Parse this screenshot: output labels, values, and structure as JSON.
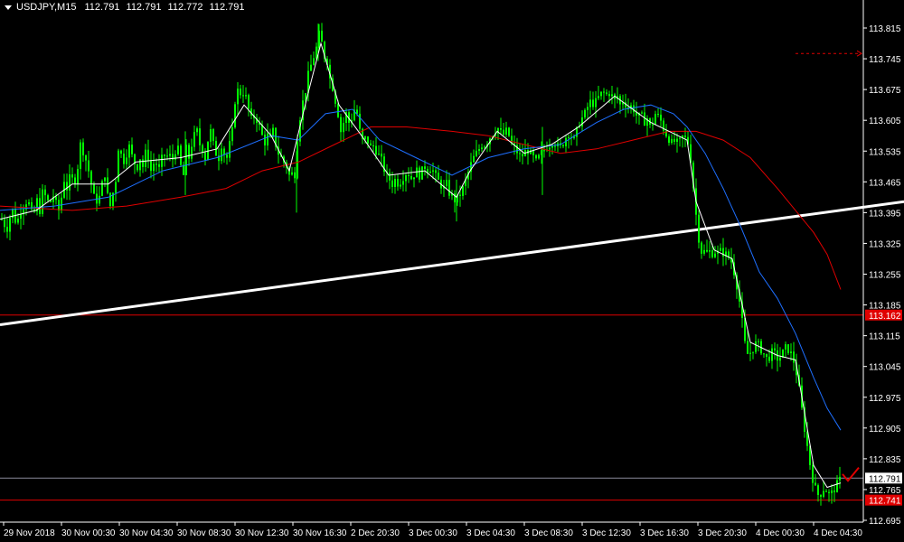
{
  "header": {
    "symbol": "USDJPY,M15",
    "open": "112.791",
    "high": "112.791",
    "low": "112.772",
    "close": "112.791"
  },
  "colors": {
    "background": "#000000",
    "axis": "#ffffff",
    "candle": "#00ff00",
    "ma_fast": "#ffffff",
    "ma_mid": "#1e6fff",
    "ma_slow": "#e00000",
    "trendline": "#ffffff",
    "level_line": "#e00000",
    "bid_line": "#8a8a9a",
    "tag_bg_red": "#e00000",
    "checkmark": "#e00000"
  },
  "icons": {
    "menu": "triangle-down-icon",
    "annotation": "red-checkmark-icon"
  },
  "chart_data": {
    "type": "candlestick",
    "ylim": [
      112.695,
      113.835
    ],
    "price_ticks": [
      "113.815",
      "113.745",
      "113.675",
      "113.605",
      "113.535",
      "113.465",
      "113.395",
      "113.325",
      "113.255",
      "113.185",
      "113.115",
      "113.045",
      "112.975",
      "112.905",
      "112.835",
      "112.765",
      "112.695"
    ],
    "time_ticks": [
      "29 Nov 2018",
      "30 Nov 00:30",
      "30 Nov 04:30",
      "30 Nov 08:30",
      "30 Nov 12:30",
      "30 Nov 16:30",
      "2 Dec 20:30",
      "3 Dec 00:30",
      "3 Dec 04:30",
      "3 Dec 08:30",
      "3 Dec 12:30",
      "3 Dec 16:30",
      "3 Dec 20:30",
      "4 Dec 00:30",
      "4 Dec 04:30"
    ],
    "price_tags": [
      {
        "name": "level-upper",
        "label": "113.162",
        "value": 113.162
      },
      {
        "name": "bid",
        "label": "112.791",
        "value": 112.791
      },
      {
        "name": "level-lower",
        "label": "112.741",
        "value": 112.741
      }
    ],
    "dotted_level": 113.757,
    "close_path": [
      [
        0,
        113.39
      ],
      [
        4,
        113.37
      ],
      [
        8,
        113.36
      ],
      [
        10,
        113.38
      ],
      [
        14,
        113.4
      ],
      [
        18,
        113.37
      ],
      [
        22,
        113.39
      ],
      [
        25,
        113.42
      ],
      [
        27,
        113.4
      ],
      [
        30,
        113.43
      ],
      [
        34,
        113.4
      ],
      [
        37,
        113.38
      ],
      [
        40,
        113.43
      ],
      [
        44,
        113.4
      ],
      [
        47,
        113.44
      ],
      [
        51,
        113.43
      ],
      [
        55,
        113.41
      ],
      [
        58,
        113.44
      ],
      [
        61,
        113.42
      ],
      [
        65,
        113.4
      ],
      [
        68,
        113.43
      ],
      [
        71,
        113.47
      ],
      [
        74,
        113.45
      ],
      [
        78,
        113.48
      ],
      [
        82,
        113.46
      ],
      [
        86,
        113.5
      ],
      [
        89,
        113.55
      ],
      [
        93,
        113.53
      ],
      [
        97,
        113.5
      ],
      [
        101,
        113.46
      ],
      [
        104,
        113.43
      ],
      [
        108,
        113.42
      ],
      [
        112,
        113.44
      ],
      [
        115,
        113.5
      ],
      [
        118,
        113.45
      ],
      [
        121,
        113.4
      ],
      [
        125,
        113.44
      ],
      [
        128,
        113.47
      ],
      [
        130,
        113.55
      ],
      [
        133,
        113.53
      ],
      [
        136,
        113.52
      ],
      [
        139,
        113.5
      ],
      [
        141,
        113.56
      ],
      [
        145,
        113.53
      ],
      [
        148,
        113.51
      ],
      [
        152,
        113.5
      ],
      [
        155,
        113.52
      ],
      [
        158,
        113.5
      ],
      [
        161,
        113.53
      ],
      [
        164,
        113.52
      ],
      [
        168,
        113.48
      ],
      [
        171,
        113.52
      ],
      [
        174,
        113.5
      ],
      [
        177,
        113.49
      ],
      [
        180,
        113.53
      ],
      [
        184,
        113.52
      ],
      [
        187,
        113.53
      ],
      [
        190,
        113.51
      ],
      [
        193,
        113.53
      ],
      [
        196,
        113.55
      ],
      [
        200,
        113.5
      ],
      [
        203,
        113.48
      ],
      [
        206,
        113.54
      ],
      [
        209,
        113.52
      ],
      [
        212,
        113.55
      ],
      [
        215,
        113.57
      ],
      [
        218,
        113.58
      ],
      [
        221,
        113.55
      ],
      [
        224,
        113.54
      ],
      [
        227,
        113.52
      ],
      [
        230,
        113.56
      ],
      [
        233,
        113.58
      ],
      [
        236,
        113.55
      ],
      [
        239,
        113.53
      ],
      [
        242,
        113.52
      ],
      [
        245,
        113.55
      ],
      [
        248,
        113.53
      ],
      [
        251,
        113.52
      ],
      [
        254,
        113.55
      ],
      [
        257,
        113.58
      ],
      [
        260,
        113.65
      ],
      [
        264,
        113.68
      ],
      [
        267,
        113.66
      ],
      [
        270,
        113.67
      ],
      [
        273,
        113.65
      ],
      [
        276,
        113.62
      ],
      [
        279,
        113.6
      ],
      [
        282,
        113.62
      ],
      [
        285,
        113.6
      ],
      [
        289,
        113.58
      ],
      [
        292,
        113.55
      ],
      [
        296,
        113.57
      ],
      [
        299,
        113.56
      ],
      [
        302,
        113.58
      ],
      [
        305,
        113.55
      ],
      [
        308,
        113.53
      ],
      [
        311,
        113.52
      ],
      [
        314,
        113.51
      ],
      [
        317,
        113.5
      ],
      [
        320,
        113.48
      ],
      [
        322,
        113.5
      ],
      [
        325,
        113.45
      ],
      [
        328,
        113.55
      ],
      [
        331,
        113.6
      ],
      [
        334,
        113.64
      ],
      [
        337,
        113.66
      ],
      [
        340,
        113.7
      ],
      [
        344,
        113.73
      ],
      [
        347,
        113.75
      ],
      [
        350,
        113.77
      ],
      [
        353,
        113.8
      ],
      [
        356,
        113.78
      ],
      [
        359,
        113.75
      ],
      [
        362,
        113.74
      ],
      [
        365,
        113.7
      ],
      [
        368,
        113.68
      ],
      [
        371,
        113.65
      ],
      [
        374,
        113.62
      ],
      [
        377,
        113.58
      ],
      [
        380,
        113.6
      ],
      [
        383,
        113.62
      ],
      [
        386,
        113.6
      ],
      [
        389,
        113.61
      ],
      [
        392,
        113.63
      ],
      [
        395,
        113.62
      ],
      [
        398,
        113.58
      ],
      [
        402,
        113.55
      ],
      [
        405,
        113.57
      ],
      [
        408,
        113.55
      ],
      [
        411,
        113.54
      ],
      [
        414,
        113.55
      ],
      [
        417,
        113.53
      ],
      [
        421,
        113.52
      ],
      [
        424,
        113.5
      ],
      [
        427,
        113.48
      ],
      [
        431,
        113.47
      ],
      [
        434,
        113.46
      ],
      [
        437,
        113.47
      ],
      [
        441,
        113.46
      ],
      [
        444,
        113.47
      ],
      [
        447,
        113.48
      ],
      [
        451,
        113.49
      ],
      [
        454,
        113.47
      ],
      [
        457,
        113.48
      ],
      [
        461,
        113.49
      ],
      [
        464,
        113.48
      ],
      [
        467,
        113.49
      ],
      [
        470,
        113.5
      ],
      [
        474,
        113.49
      ],
      [
        477,
        113.5
      ],
      [
        481,
        113.48
      ],
      [
        484,
        113.47
      ],
      [
        487,
        113.46
      ],
      [
        491,
        113.45
      ],
      [
        494,
        113.46
      ],
      [
        497,
        113.44
      ],
      [
        501,
        113.43
      ],
      [
        504,
        113.42
      ],
      [
        507,
        113.43
      ],
      [
        510,
        113.44
      ],
      [
        514,
        113.46
      ],
      [
        517,
        113.48
      ],
      [
        520,
        113.5
      ],
      [
        524,
        113.52
      ],
      [
        527,
        113.53
      ],
      [
        530,
        113.54
      ],
      [
        533,
        113.55
      ],
      [
        536,
        113.55
      ],
      [
        540,
        113.56
      ],
      [
        543,
        113.57
      ],
      [
        547,
        113.58
      ],
      [
        550,
        113.59
      ],
      [
        553,
        113.58
      ],
      [
        556,
        113.57
      ],
      [
        560,
        113.58
      ],
      [
        563,
        113.57
      ],
      [
        566,
        113.55
      ],
      [
        570,
        113.54
      ],
      [
        573,
        113.53
      ],
      [
        576,
        113.52
      ],
      [
        580,
        113.53
      ],
      [
        583,
        113.54
      ],
      [
        586,
        113.53
      ],
      [
        590,
        113.52
      ],
      [
        593,
        113.51
      ],
      [
        596,
        113.52
      ],
      [
        599,
        113.53
      ],
      [
        603,
        113.54
      ],
      [
        606,
        113.55
      ],
      [
        609,
        113.55
      ],
      [
        612,
        113.56
      ],
      [
        615,
        113.55
      ],
      [
        619,
        113.54
      ],
      [
        622,
        113.55
      ],
      [
        625,
        113.56
      ],
      [
        628,
        113.58
      ],
      [
        631,
        113.57
      ],
      [
        635,
        113.56
      ],
      [
        638,
        113.58
      ],
      [
        641,
        113.6
      ],
      [
        644,
        113.61
      ],
      [
        647,
        113.62
      ],
      [
        651,
        113.64
      ],
      [
        654,
        113.65
      ],
      [
        657,
        113.64
      ],
      [
        660,
        113.65
      ],
      [
        663,
        113.66
      ],
      [
        667,
        113.67
      ],
      [
        670,
        113.66
      ],
      [
        673,
        113.67
      ],
      [
        677,
        113.66
      ],
      [
        680,
        113.65
      ],
      [
        683,
        113.66
      ],
      [
        686,
        113.64
      ],
      [
        689,
        113.65
      ],
      [
        693,
        113.64
      ],
      [
        696,
        113.63
      ],
      [
        699,
        113.64
      ],
      [
        703,
        113.62
      ],
      [
        706,
        113.61
      ],
      [
        709,
        113.62
      ],
      [
        712,
        113.6
      ],
      [
        716,
        113.61
      ],
      [
        719,
        113.59
      ],
      [
        722,
        113.6
      ],
      [
        725,
        113.62
      ],
      [
        729,
        113.61
      ],
      [
        732,
        113.6
      ],
      [
        735,
        113.58
      ],
      [
        738,
        113.57
      ],
      [
        741,
        113.56
      ],
      [
        744,
        113.55
      ],
      [
        747,
        113.56
      ],
      [
        750,
        113.55
      ],
      [
        753,
        113.56
      ],
      [
        756,
        113.57
      ],
      [
        759,
        113.56
      ],
      [
        762,
        113.55
      ],
      [
        765,
        113.5
      ],
      [
        768,
        113.43
      ],
      [
        771,
        113.37
      ],
      [
        774,
        113.32
      ],
      [
        777,
        113.3
      ],
      [
        780,
        113.31
      ],
      [
        783,
        113.3
      ],
      [
        786,
        113.31
      ],
      [
        789,
        113.3
      ],
      [
        792,
        113.31
      ],
      [
        795,
        113.3
      ],
      [
        798,
        113.31
      ],
      [
        801,
        113.3
      ],
      [
        804,
        113.3
      ],
      [
        807,
        113.29
      ],
      [
        810,
        113.28
      ],
      [
        813,
        113.25
      ],
      [
        816,
        113.22
      ],
      [
        819,
        113.18
      ],
      [
        822,
        113.13
      ],
      [
        825,
        113.08
      ],
      [
        828,
        113.07
      ],
      [
        831,
        113.08
      ],
      [
        834,
        113.09
      ],
      [
        837,
        113.1
      ],
      [
        840,
        113.09
      ],
      [
        843,
        113.08
      ],
      [
        846,
        113.07
      ],
      [
        849,
        113.06
      ],
      [
        852,
        113.07
      ],
      [
        855,
        113.08
      ],
      [
        858,
        113.07
      ],
      [
        861,
        113.06
      ],
      [
        864,
        113.07
      ],
      [
        867,
        113.08
      ],
      [
        870,
        113.09
      ],
      [
        873,
        113.08
      ],
      [
        876,
        113.07
      ],
      [
        879,
        113.05
      ],
      [
        882,
        113.02
      ],
      [
        885,
        112.98
      ],
      [
        888,
        112.93
      ],
      [
        891,
        112.89
      ],
      [
        894,
        112.85
      ],
      [
        897,
        112.81
      ],
      [
        900,
        112.78
      ],
      [
        903,
        112.76
      ],
      [
        906,
        112.75
      ],
      [
        909,
        112.76
      ],
      [
        912,
        112.77
      ],
      [
        915,
        112.76
      ],
      [
        918,
        112.75
      ],
      [
        921,
        112.76
      ],
      [
        924,
        112.77
      ],
      [
        927,
        112.78
      ],
      [
        930,
        112.79
      ]
    ],
    "ma_fast": [
      [
        0,
        113.38
      ],
      [
        40,
        113.4
      ],
      [
        80,
        113.46
      ],
      [
        120,
        113.46
      ],
      [
        150,
        113.51
      ],
      [
        200,
        113.52
      ],
      [
        240,
        113.54
      ],
      [
        270,
        113.64
      ],
      [
        300,
        113.57
      ],
      [
        320,
        113.49
      ],
      [
        340,
        113.66
      ],
      [
        355,
        113.78
      ],
      [
        375,
        113.64
      ],
      [
        400,
        113.57
      ],
      [
        430,
        113.48
      ],
      [
        470,
        113.49
      ],
      [
        505,
        113.43
      ],
      [
        520,
        113.49
      ],
      [
        550,
        113.58
      ],
      [
        580,
        113.53
      ],
      [
        610,
        113.55
      ],
      [
        640,
        113.59
      ],
      [
        680,
        113.66
      ],
      [
        720,
        113.6
      ],
      [
        760,
        113.56
      ],
      [
        770,
        113.42
      ],
      [
        790,
        113.31
      ],
      [
        810,
        113.29
      ],
      [
        830,
        113.1
      ],
      [
        860,
        113.07
      ],
      [
        880,
        113.06
      ],
      [
        900,
        112.82
      ],
      [
        915,
        112.77
      ],
      [
        930,
        112.78
      ]
    ],
    "ma_mid": [
      [
        0,
        113.4
      ],
      [
        60,
        113.41
      ],
      [
        120,
        113.43
      ],
      [
        180,
        113.49
      ],
      [
        240,
        113.52
      ],
      [
        300,
        113.57
      ],
      [
        330,
        113.56
      ],
      [
        360,
        113.62
      ],
      [
        390,
        113.63
      ],
      [
        420,
        113.56
      ],
      [
        460,
        113.52
      ],
      [
        500,
        113.48
      ],
      [
        540,
        113.52
      ],
      [
        580,
        113.54
      ],
      [
        620,
        113.55
      ],
      [
        660,
        113.6
      ],
      [
        690,
        113.63
      ],
      [
        720,
        113.64
      ],
      [
        745,
        113.62
      ],
      [
        760,
        113.59
      ],
      [
        780,
        113.53
      ],
      [
        800,
        113.45
      ],
      [
        820,
        113.36
      ],
      [
        840,
        113.26
      ],
      [
        860,
        113.2
      ],
      [
        880,
        113.12
      ],
      [
        900,
        113.02
      ],
      [
        915,
        112.95
      ],
      [
        930,
        112.9
      ]
    ],
    "ma_slow": [
      [
        0,
        113.41
      ],
      [
        80,
        113.4
      ],
      [
        140,
        113.41
      ],
      [
        200,
        113.43
      ],
      [
        250,
        113.45
      ],
      [
        290,
        113.49
      ],
      [
        330,
        113.51
      ],
      [
        370,
        113.55
      ],
      [
        410,
        113.59
      ],
      [
        450,
        113.59
      ],
      [
        500,
        113.58
      ],
      [
        540,
        113.57
      ],
      [
        580,
        113.55
      ],
      [
        620,
        113.53
      ],
      [
        660,
        113.54
      ],
      [
        700,
        113.56
      ],
      [
        740,
        113.58
      ],
      [
        770,
        113.58
      ],
      [
        800,
        113.56
      ],
      [
        830,
        113.52
      ],
      [
        860,
        113.45
      ],
      [
        880,
        113.4
      ],
      [
        900,
        113.35
      ],
      [
        915,
        113.3
      ],
      [
        930,
        113.22
      ]
    ],
    "trendline": [
      [
        0,
        113.14
      ],
      [
        1000,
        113.42
      ]
    ]
  }
}
